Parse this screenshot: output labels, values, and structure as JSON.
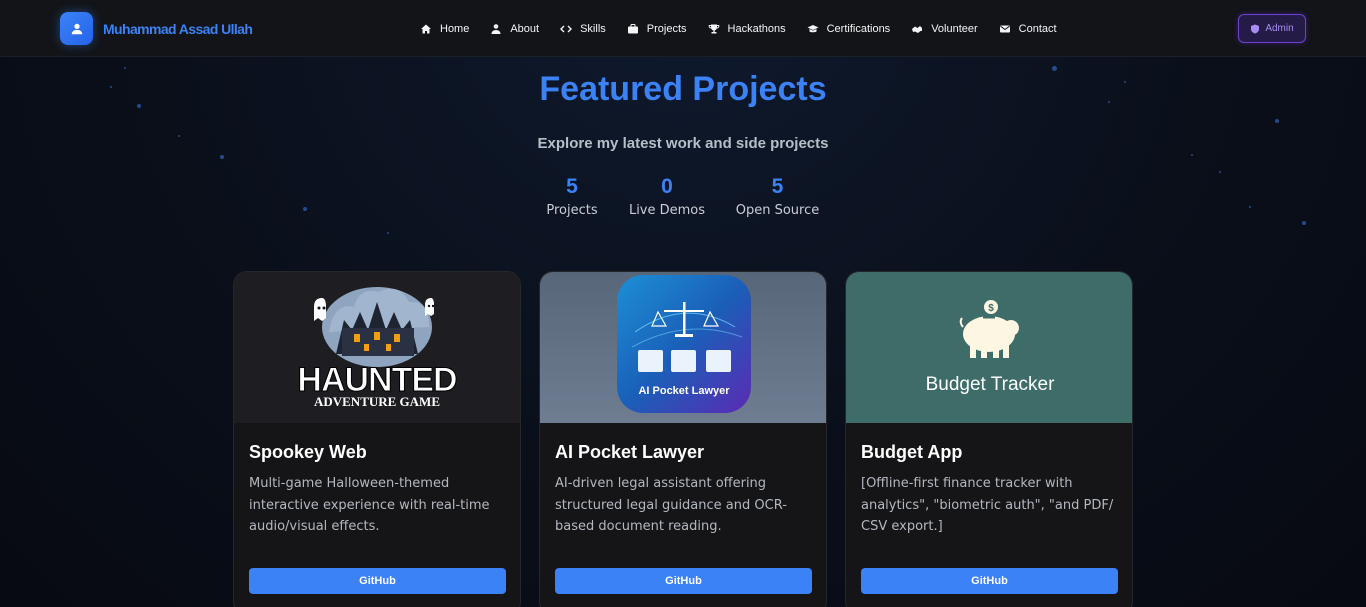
{
  "brand": {
    "name": "Muhammad Assad Ullah",
    "icon": "user-icon"
  },
  "nav": {
    "items": [
      {
        "label": "Home",
        "icon": "home-icon"
      },
      {
        "label": "About",
        "icon": "person-icon"
      },
      {
        "label": "Skills",
        "icon": "code-icon"
      },
      {
        "label": "Projects",
        "icon": "briefcase-icon"
      },
      {
        "label": "Hackathons",
        "icon": "trophy-icon"
      },
      {
        "label": "Certifications",
        "icon": "graduation-cap-icon"
      },
      {
        "label": "Volunteer",
        "icon": "handshake-icon"
      },
      {
        "label": "Contact",
        "icon": "mail-icon"
      }
    ],
    "admin_label": "Admin",
    "admin_icon": "shield-icon"
  },
  "hero": {
    "title": "Featured Projects",
    "subtitle": "Explore my latest work and side projects"
  },
  "stats": [
    {
      "value": "5",
      "label": "Projects"
    },
    {
      "value": "0",
      "label": "Live Demos"
    },
    {
      "value": "5",
      "label": "Open Source"
    }
  ],
  "projects": [
    {
      "title": "Spookey Web",
      "description": "Multi-game Halloween-themed interactive experience with real-time audio/visual effects.",
      "button": "GitHub",
      "image_text": {
        "line1": "HAUNTED",
        "line2": "ADVENTURE GAME"
      }
    },
    {
      "title": "AI Pocket Lawyer",
      "description": "AI-driven legal assistant offering structured legal guidance and OCR-based document reading.",
      "button": "GitHub",
      "image_text": {
        "line1": "AI Pocket Lawyer"
      }
    },
    {
      "title": "Budget App",
      "description": "[Offline-first finance tracker with analytics\", \"biometric auth\", \"and PDF/ CSV export.]",
      "button": "GitHub",
      "image_text": {
        "line1": "Budget Tracker"
      }
    }
  ],
  "colors": {
    "accent": "#3b82f6",
    "admin": "#7c3aed",
    "card_bg": "#151517"
  }
}
